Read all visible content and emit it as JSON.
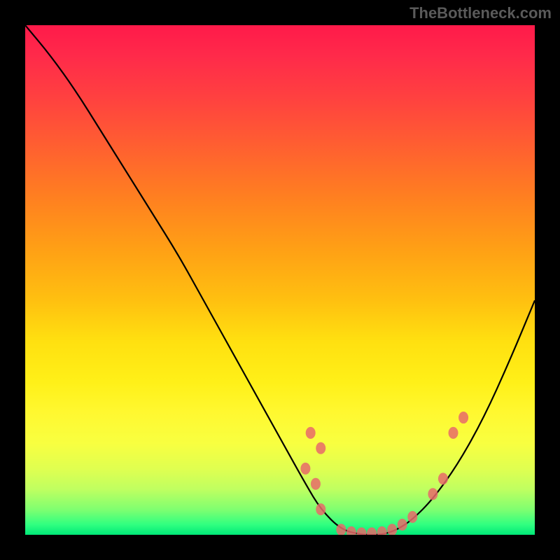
{
  "watermark": "TheBottleneck.com",
  "chart_data": {
    "type": "line",
    "title": "",
    "xlabel": "",
    "ylabel": "",
    "xlim": [
      0,
      100
    ],
    "ylim": [
      0,
      100
    ],
    "grid": false,
    "series": [
      {
        "name": "curve",
        "x": [
          0,
          5,
          10,
          15,
          20,
          25,
          30,
          35,
          40,
          45,
          50,
          55,
          58,
          62,
          66,
          70,
          73,
          76,
          80,
          85,
          90,
          95,
          100
        ],
        "y": [
          100,
          94,
          87,
          79,
          71,
          63,
          55,
          46,
          37,
          28,
          19,
          10,
          5,
          1,
          0,
          0,
          1,
          3,
          7,
          14,
          23,
          34,
          46
        ]
      }
    ],
    "markers": [
      {
        "x": 56,
        "y": 20
      },
      {
        "x": 58,
        "y": 17
      },
      {
        "x": 55,
        "y": 13
      },
      {
        "x": 57,
        "y": 10
      },
      {
        "x": 58,
        "y": 5
      },
      {
        "x": 62,
        "y": 1
      },
      {
        "x": 64,
        "y": 0.5
      },
      {
        "x": 66,
        "y": 0.3
      },
      {
        "x": 68,
        "y": 0.3
      },
      {
        "x": 70,
        "y": 0.5
      },
      {
        "x": 72,
        "y": 1
      },
      {
        "x": 74,
        "y": 2
      },
      {
        "x": 76,
        "y": 3.5
      },
      {
        "x": 80,
        "y": 8
      },
      {
        "x": 82,
        "y": 11
      },
      {
        "x": 84,
        "y": 20
      },
      {
        "x": 86,
        "y": 23
      }
    ],
    "gradient_stops": [
      {
        "pos": 0,
        "color": "#ff1a4a"
      },
      {
        "pos": 50,
        "color": "#ffd010"
      },
      {
        "pos": 100,
        "color": "#00e878"
      }
    ]
  }
}
